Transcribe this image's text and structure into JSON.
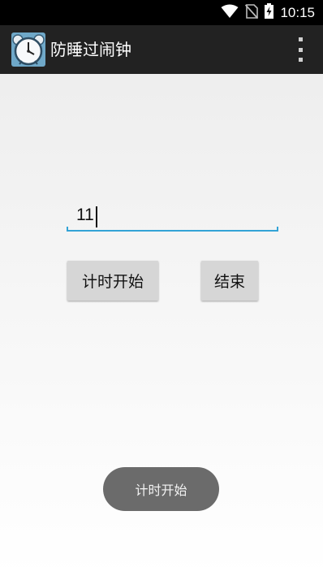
{
  "status_bar": {
    "time": "10:15",
    "icons": [
      "wifi-icon",
      "no-sim-icon",
      "battery-charging-icon"
    ]
  },
  "action_bar": {
    "app_icon": "alarm-clock-icon",
    "title": "防睡过闹钟",
    "overflow_icon": "overflow-menu-icon"
  },
  "main": {
    "minutes_input": {
      "value": "11"
    },
    "start_button_label": "计时开始",
    "end_button_label": "结束"
  },
  "toast": {
    "text": "计时开始"
  },
  "colors": {
    "status_bar": "#000000",
    "action_bar": "#222222",
    "input_underline": "#33a3d6",
    "button": "#d6d6d6",
    "toast": "#6b6b6b"
  }
}
